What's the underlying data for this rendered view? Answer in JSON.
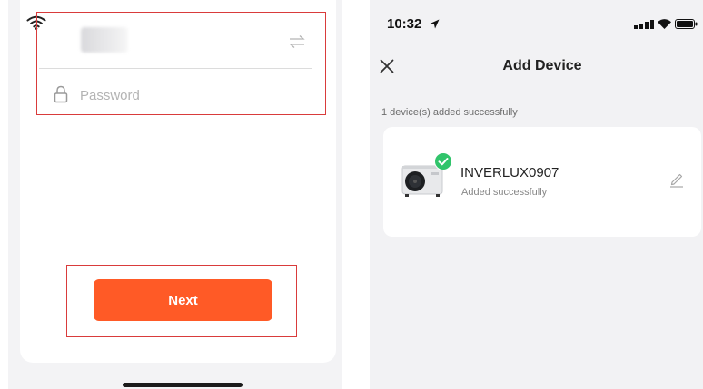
{
  "left_screen": {
    "password_field": {
      "placeholder": "Password",
      "value": ""
    },
    "next_button": {
      "label": "Next",
      "color": "#ff5a26"
    },
    "highlight_color": "#d93b3b",
    "icons": [
      "wifi-icon",
      "switch-network-icon",
      "lock-icon"
    ]
  },
  "right_screen": {
    "status_bar": {
      "time": "10:32"
    },
    "nav": {
      "title": "Add Device"
    },
    "summary": "1 device(s) added successfully",
    "device": {
      "name": "INVERLUX0907",
      "status": "Added successfully",
      "badge_color": "#31c46b"
    },
    "icons": [
      "location-arrow-icon",
      "signal-icon",
      "wifi-icon",
      "battery-icon",
      "close-icon",
      "check-icon",
      "edit-icon"
    ]
  }
}
